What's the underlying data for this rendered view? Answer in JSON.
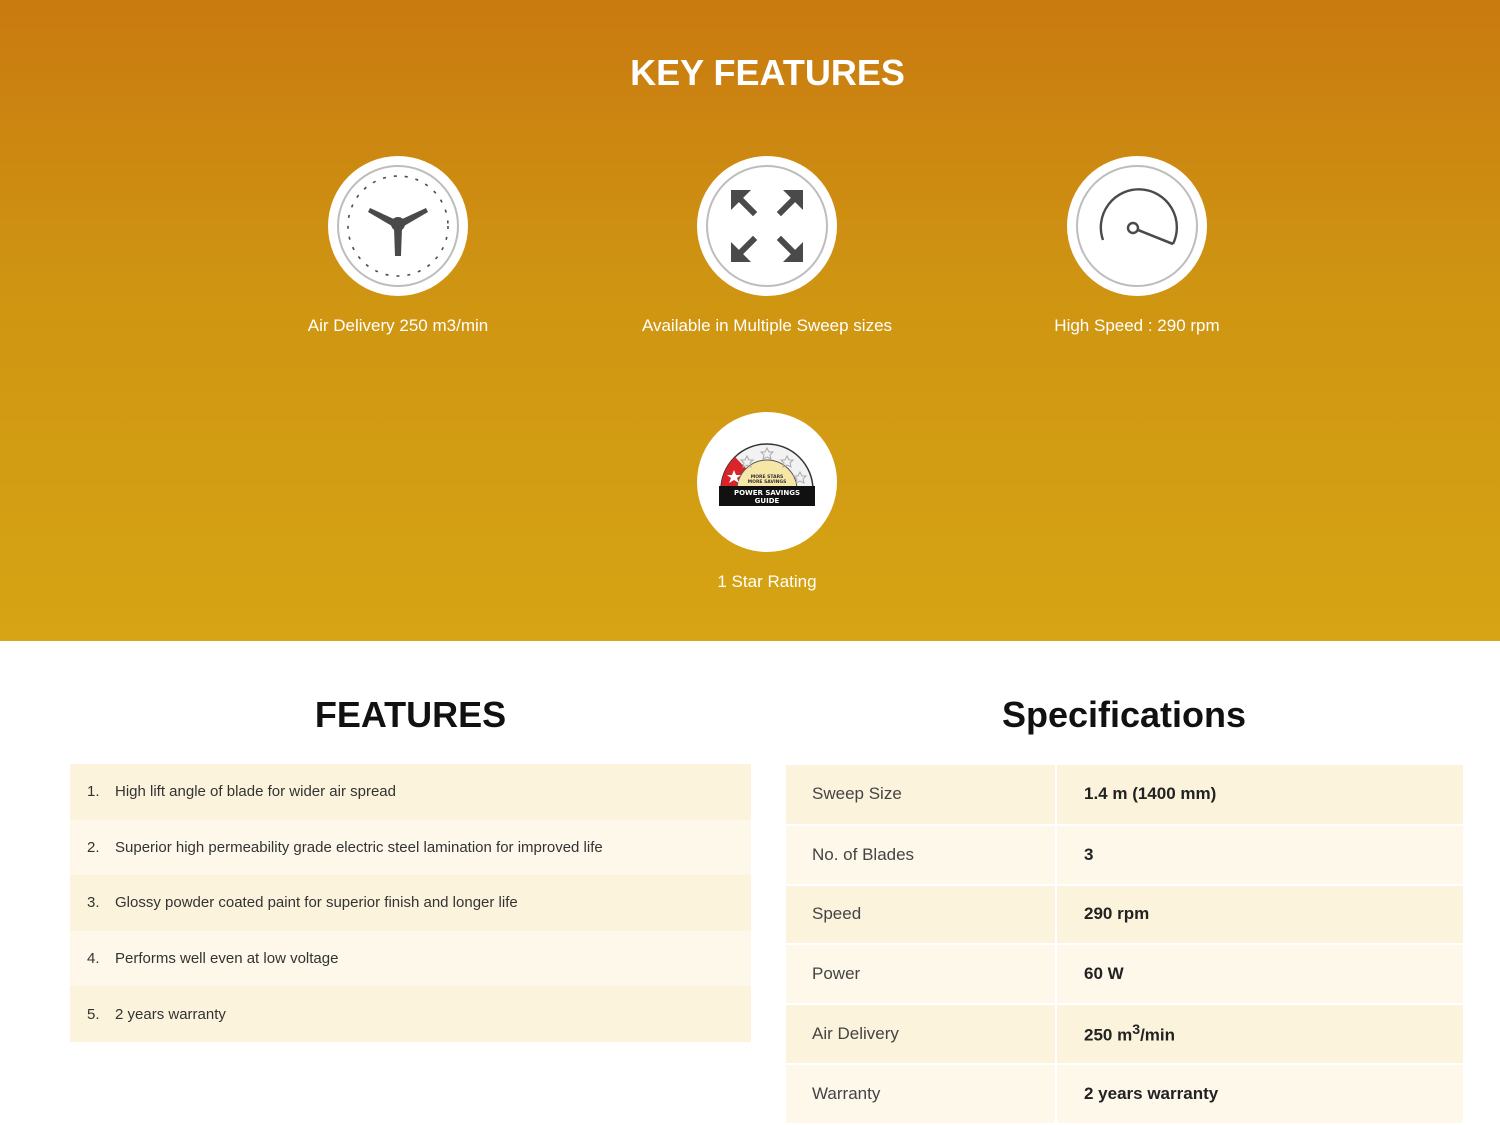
{
  "hero": {
    "title": "KEY FEATURES",
    "features": [
      {
        "label": "Air Delivery 250 m3/min",
        "icon": "fan-icon"
      },
      {
        "label": "Available in Multiple Sweep sizes",
        "icon": "expand-arrows-icon"
      },
      {
        "label": "High Speed : 290 rpm",
        "icon": "speedometer-icon"
      },
      {
        "label": "1 Star Rating",
        "icon": "power-savings-guide-icon"
      }
    ],
    "badge": {
      "line1": "MORE STARS",
      "line2": "MORE SAVINGS",
      "line3": "POWER SAVINGS",
      "line4": "GUIDE"
    }
  },
  "features": {
    "title": "FEATURES",
    "items": [
      {
        "num": "1.",
        "text": "High lift angle of blade for wider air spread"
      },
      {
        "num": "2.",
        "text": "Superior high permeability grade electric steel lamination for improved life"
      },
      {
        "num": "3.",
        "text": "Glossy powder coated paint for superior finish and longer life"
      },
      {
        "num": "4.",
        "text": "Performs well even at low voltage"
      },
      {
        "num": "5.",
        "text": "2 years warranty"
      }
    ]
  },
  "specs": {
    "title": "Specifications",
    "rows": [
      {
        "key": "Sweep Size",
        "value": "1.4 m (1400 mm)"
      },
      {
        "key": "No. of Blades",
        "value": "3"
      },
      {
        "key": "Speed",
        "value": "290 rpm"
      },
      {
        "key": "Power",
        "value": "60 W"
      },
      {
        "key": "Air Delivery",
        "value": "250 m",
        "sup": "3",
        "suffix": "/min"
      },
      {
        "key": "Warranty",
        "value": "2 years warranty"
      }
    ]
  },
  "colors": {
    "hero_top": "#c97a10",
    "hero_bottom": "#d6a414",
    "row_odd": "#fbf3dc",
    "row_even": "#fdf8ea",
    "icon_gray": "#4a4a4a",
    "star_red": "#d9252a"
  }
}
